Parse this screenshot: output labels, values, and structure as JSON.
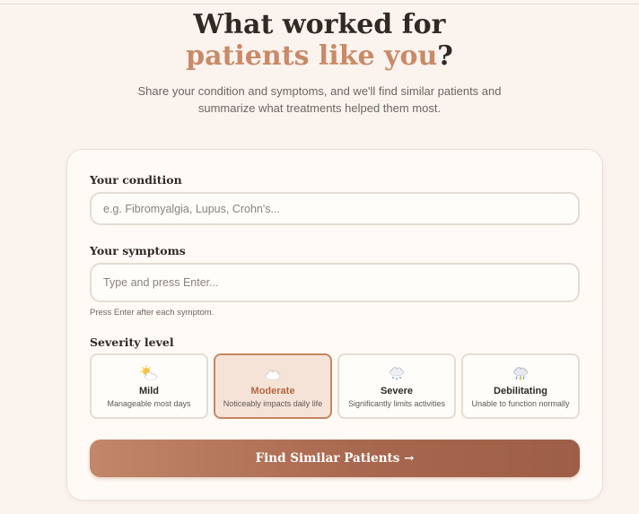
{
  "hero": {
    "title_line1": "What worked for",
    "title_accent": "patients like you",
    "title_suffix": "?",
    "subtitle": "Share your condition and symptoms, and we'll find similar patients and summarize what treatments helped them most."
  },
  "form": {
    "condition": {
      "label": "Your condition",
      "value": "",
      "placeholder": "e.g. Fibromyalgia, Lupus, Crohn's..."
    },
    "symptoms": {
      "label": "Your symptoms",
      "value": "",
      "placeholder": "Type and press Enter...",
      "hint": "Press Enter after each symptom."
    },
    "severity": {
      "label": "Severity level",
      "selected": "Moderate",
      "options": [
        {
          "name": "Mild",
          "description": "Manageable most days",
          "icon": "sun-behind-cloud-icon"
        },
        {
          "name": "Moderate",
          "description": "Noticeably impacts daily life",
          "icon": "cloud-icon"
        },
        {
          "name": "Severe",
          "description": "Significantly limits activities",
          "icon": "cloud-with-snow-icon"
        },
        {
          "name": "Debilitating",
          "description": "Unable to function normally",
          "icon": "cloud-with-rain-icon"
        }
      ]
    },
    "submit_label": "Find Similar Patients →"
  },
  "colors": {
    "background": "#fbf3ee",
    "accent": "#c98a68",
    "selected_border": "#c68562",
    "selected_bg": "#f6e3d8",
    "button_start": "#c2866a",
    "button_end": "#9d5e47"
  }
}
